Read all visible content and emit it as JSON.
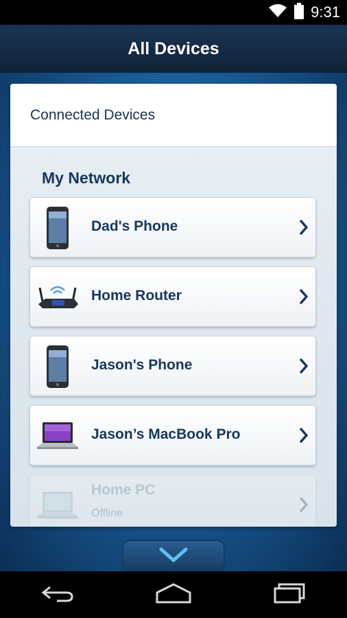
{
  "status_bar": {
    "time": "9:31"
  },
  "app_bar": {
    "title": "All Devices"
  },
  "panel": {
    "header": "Connected Devices",
    "section_title": "My Network",
    "devices": [
      {
        "name": "Dad's Phone",
        "icon": "phone-icon",
        "status": ""
      },
      {
        "name": "Home Router",
        "icon": "router-icon",
        "status": ""
      },
      {
        "name": "Jason's Phone",
        "icon": "phone-icon",
        "status": ""
      },
      {
        "name": "Jason’s MacBook Pro",
        "icon": "laptop-icon",
        "status": ""
      },
      {
        "name": "Home PC",
        "icon": "laptop-icon",
        "status": "Offline"
      }
    ]
  },
  "colors": {
    "accent": "#17375e",
    "app_bar": "#1b3454",
    "background": "#1a5f9a"
  }
}
